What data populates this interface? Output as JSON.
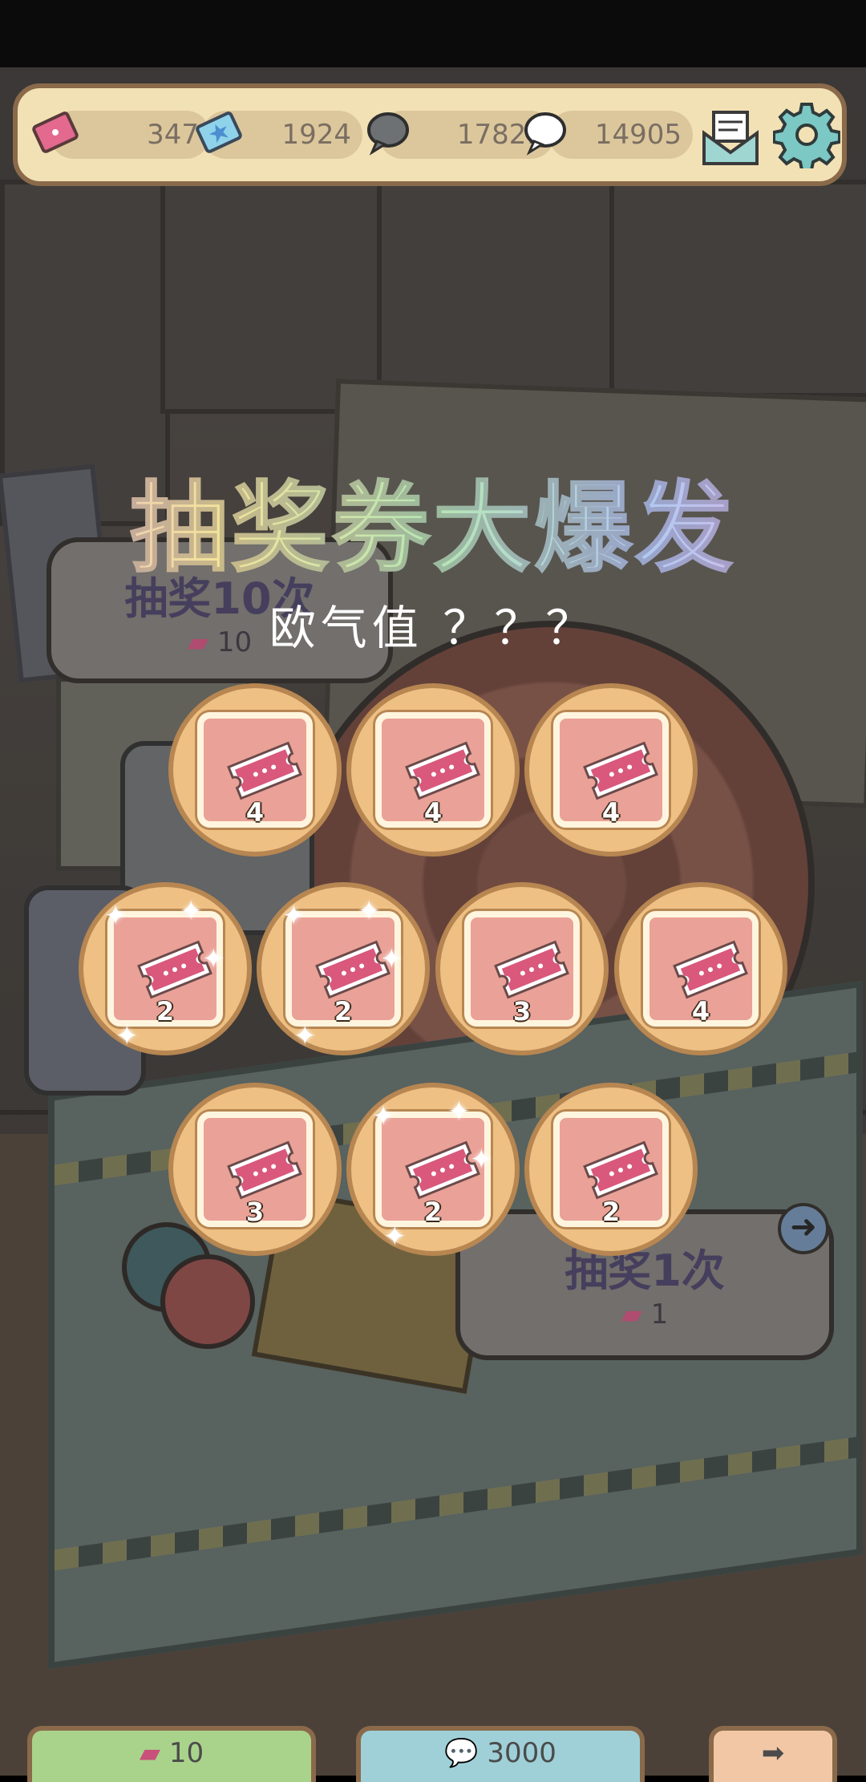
{
  "resources": [
    {
      "name": "ticket",
      "value": "347",
      "icon": "ticket-icon"
    },
    {
      "name": "star-ticket",
      "value": "1924",
      "icon": "star-ticket-icon"
    },
    {
      "name": "dark-bubble",
      "value": "17821",
      "icon": "dark-bubble-icon"
    },
    {
      "name": "white-bubble",
      "value": "14905",
      "icon": "white-bubble-icon"
    }
  ],
  "title": "抽奖券大爆发",
  "subtitle": "欧气值 ？？？",
  "background_buttons": {
    "draw_ten": {
      "label": "抽奖10次",
      "cost": "10"
    },
    "draw_one": {
      "label": "抽奖1次",
      "cost": "1"
    }
  },
  "prizes": [
    {
      "count": "4",
      "sparkle": false
    },
    {
      "count": "4",
      "sparkle": false
    },
    {
      "count": "4",
      "sparkle": false
    },
    {
      "count": "2",
      "sparkle": true
    },
    {
      "count": "2",
      "sparkle": true
    },
    {
      "count": "3",
      "sparkle": false
    },
    {
      "count": "4",
      "sparkle": false
    },
    {
      "count": "3",
      "sparkle": false
    },
    {
      "count": "2",
      "sparkle": true
    },
    {
      "count": "2",
      "sparkle": false
    }
  ],
  "bottom_tabs": [
    {
      "value": "10",
      "icon": "ticket-icon"
    },
    {
      "value": "3000",
      "icon": "bubble-icon"
    },
    {
      "value": "",
      "icon": "exit-icon"
    }
  ],
  "colors": {
    "accent": "#eec084",
    "card": "#eaa197",
    "ticket": "#d9587c",
    "topbar": "#f3e1b6"
  }
}
